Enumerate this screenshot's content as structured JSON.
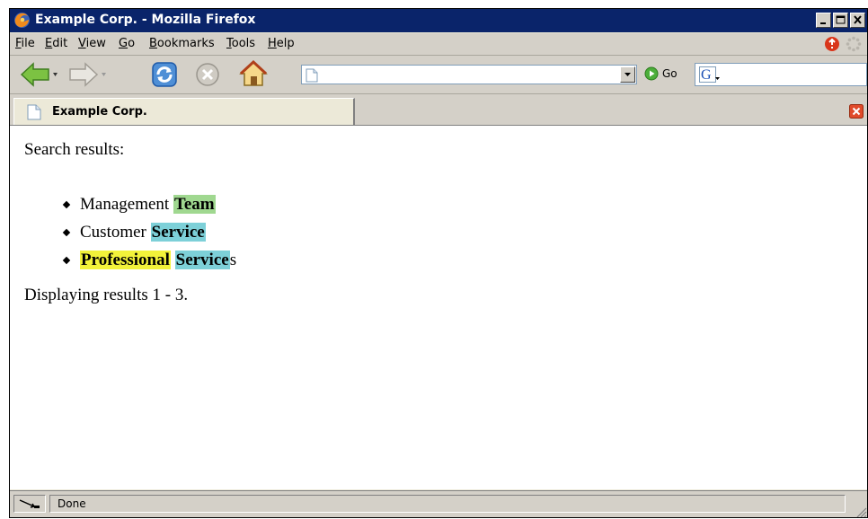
{
  "window": {
    "title": "Example Corp. - Mozilla Firefox"
  },
  "menu": {
    "items": [
      {
        "accel": "F",
        "rest": "ile"
      },
      {
        "accel": "E",
        "rest": "dit"
      },
      {
        "accel": "V",
        "rest": "iew"
      },
      {
        "accel": "G",
        "rest": "o"
      },
      {
        "accel": "B",
        "rest": "ookmarks"
      },
      {
        "accel": "T",
        "rest": "ools"
      },
      {
        "accel": "H",
        "rest": "elp"
      }
    ]
  },
  "navigation": {
    "url_value": "",
    "go_label": "Go",
    "search_value": ""
  },
  "tab": {
    "title": "Example Corp."
  },
  "page": {
    "heading": "Search results:",
    "results": [
      {
        "segments": [
          {
            "text": "Management ",
            "highlight": ""
          },
          {
            "text": "Team",
            "highlight": "#a0d890"
          }
        ]
      },
      {
        "segments": [
          {
            "text": "Customer ",
            "highlight": ""
          },
          {
            "text": "Service",
            "highlight": "#7dd0d8"
          }
        ]
      },
      {
        "segments": [
          {
            "text": "Professional",
            "highlight": "#f2f23a"
          },
          {
            "text": " ",
            "highlight": ""
          },
          {
            "text": "Service",
            "highlight": "#7dd0d8"
          },
          {
            "text": "s",
            "highlight": ""
          }
        ]
      }
    ],
    "summary": "Displaying results 1 - 3."
  },
  "status": {
    "text": "Done"
  },
  "colors": {
    "titlebar": "#0a246a",
    "chrome": "#d4d0c8",
    "highlight_team": "#a0d890",
    "highlight_service": "#7dd0d8",
    "highlight_professional": "#f2f23a"
  },
  "icons": [
    "firefox-logo-icon",
    "minimize-icon",
    "maximize-icon",
    "close-icon",
    "alert-icon",
    "throbber-icon",
    "back-arrow-icon",
    "forward-arrow-icon",
    "reload-icon",
    "stop-icon",
    "home-icon",
    "page-icon",
    "dropdown-arrow-icon",
    "go-icon",
    "google-icon",
    "tab-close-icon",
    "connection-icon",
    "resize-grip-icon"
  ]
}
